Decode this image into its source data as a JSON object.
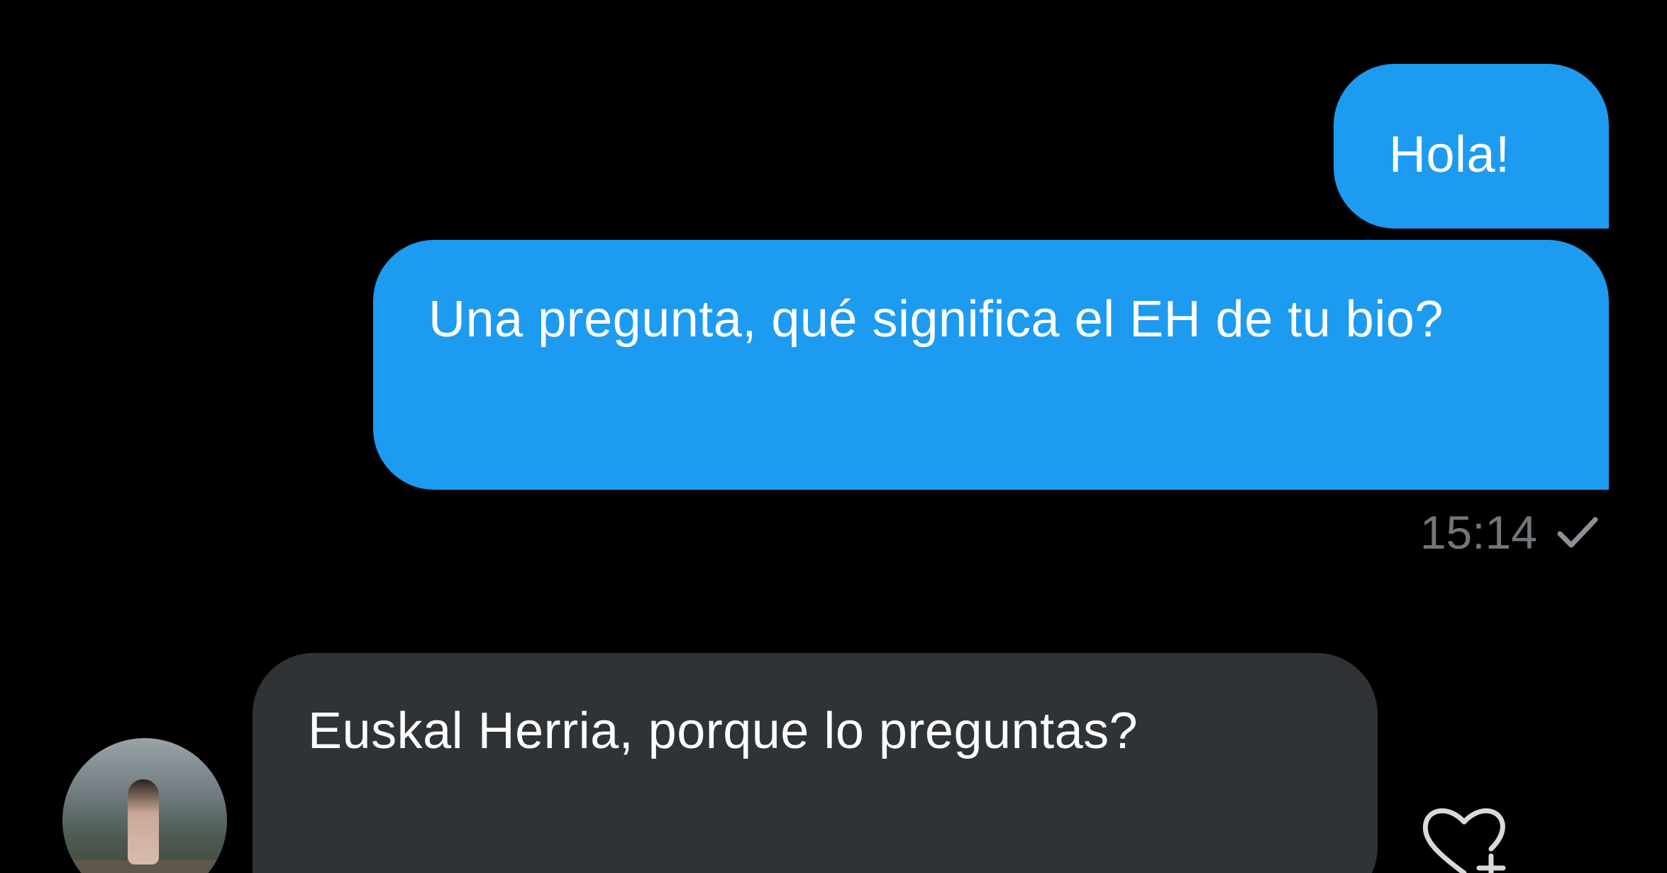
{
  "conversation": {
    "messages": [
      {
        "direction": "outgoing",
        "text": "Hola!"
      },
      {
        "direction": "outgoing",
        "text": "Una pregunta, qué significa el EH de tu bio?"
      },
      {
        "direction": "incoming",
        "text": "Euskal Herria, porque lo preguntas?"
      }
    ],
    "outgoing_meta": {
      "time": "15:14",
      "status_icon": "check-icon"
    },
    "incoming_avatar_icon": "avatar",
    "reaction_icon": "heart-plus-icon"
  },
  "colors": {
    "background": "#000000",
    "outgoing_bubble": "#1d9bf0",
    "incoming_bubble": "#2f3336",
    "meta_text": "#71767b"
  }
}
